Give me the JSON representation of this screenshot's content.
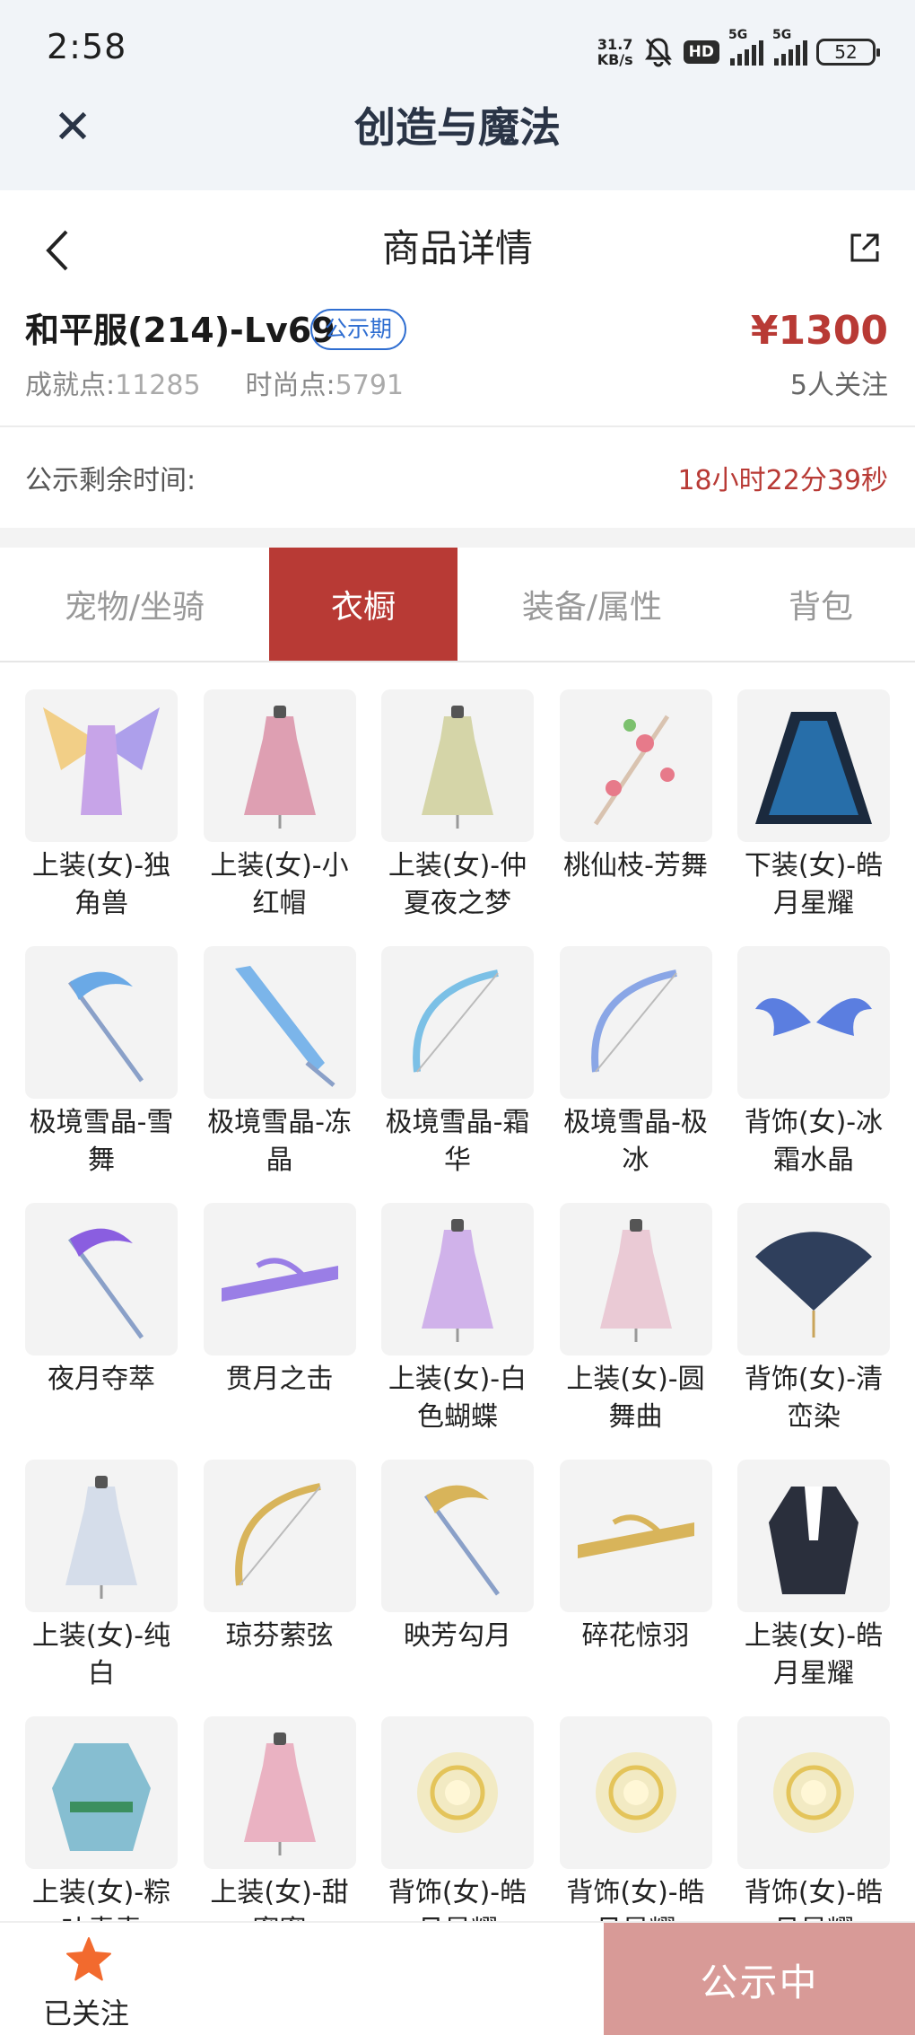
{
  "status": {
    "time": "2:58",
    "net_speed_value": "31.7",
    "net_speed_unit": "KB/s",
    "hd_badge": "HD",
    "signal_1": "5G",
    "signal_2": "5G",
    "battery": "52"
  },
  "app_bar": {
    "title": "创造与魔法",
    "close_icon": "close-icon"
  },
  "nav": {
    "title": "商品详情",
    "back_icon": "chevron-left-icon",
    "share_icon": "share-icon"
  },
  "product": {
    "name": "和平服(214)-Lv69",
    "badge": "公示期",
    "price": "¥1300",
    "follows": "5人关注",
    "achievement_label": "成就点:",
    "achievement_value": "11285",
    "fashion_label": "时尚点:",
    "fashion_value": "5791"
  },
  "remaining": {
    "label": "公示剩余时间:",
    "value": "18小时22分39秒"
  },
  "tabs": [
    {
      "label": "宠物/坐骑",
      "active": false
    },
    {
      "label": "衣橱",
      "active": true
    },
    {
      "label": "装备/属性",
      "active": false
    },
    {
      "label": "背包",
      "active": false
    }
  ],
  "items": [
    {
      "name": "上装(女)-独角兽",
      "icon": "winged-outfit-icon",
      "color": "#c7a4e8"
    },
    {
      "name": "上装(女)-小红帽",
      "icon": "dress-icon",
      "color": "#d98fa6"
    },
    {
      "name": "上装(女)-仲夏夜之梦",
      "icon": "dress-icon",
      "color": "#cfcf9a"
    },
    {
      "name": "桃仙枝-芳舞",
      "icon": "branch-icon",
      "color": "#e77a8a"
    },
    {
      "name": "下装(女)-皓月星耀",
      "icon": "skirt-icon",
      "color": "#2a7fc4"
    },
    {
      "name": "极境雪晶-雪舞",
      "icon": "scythe-icon",
      "color": "#6aa9e6"
    },
    {
      "name": "极境雪晶-冻晶",
      "icon": "sword-icon",
      "color": "#7bb5ea"
    },
    {
      "name": "极境雪晶-霜华",
      "icon": "bow-icon",
      "color": "#7bc0e6"
    },
    {
      "name": "极境雪晶-极冰",
      "icon": "bow-icon",
      "color": "#8aa6e6"
    },
    {
      "name": "背饰(女)-冰霜水晶",
      "icon": "wings-icon",
      "color": "#5b7ee0"
    },
    {
      "name": "夜月夺萃",
      "icon": "scythe-icon",
      "color": "#8a5ee0"
    },
    {
      "name": "贯月之击",
      "icon": "crossbow-icon",
      "color": "#9a7ee6"
    },
    {
      "name": "上装(女)-白色蝴蝶",
      "icon": "dress-icon",
      "color": "#c9a6e8"
    },
    {
      "name": "上装(女)-圆舞曲",
      "icon": "dress-icon",
      "color": "#e8c2cf"
    },
    {
      "name": "背饰(女)-清峦染",
      "icon": "fan-icon",
      "color": "#2f3f5c"
    },
    {
      "name": "上装(女)-纯白",
      "icon": "dress-icon",
      "color": "#cfd8e8"
    },
    {
      "name": "琼芬萦弦",
      "icon": "bow-icon",
      "color": "#d8b45a"
    },
    {
      "name": "映芳勾月",
      "icon": "scythe-icon",
      "color": "#d8b45a"
    },
    {
      "name": "碎花惊羽",
      "icon": "crossbow-icon",
      "color": "#d8b45a"
    },
    {
      "name": "上装(女)-皓月星耀",
      "icon": "jacket-icon",
      "color": "#2a2f3c"
    },
    {
      "name": "上装(女)-粽叶青青",
      "icon": "armor-icon",
      "color": "#6ab0c8"
    },
    {
      "name": "上装(女)-甜蜜蜜",
      "icon": "dress-icon",
      "color": "#e8a6b8"
    },
    {
      "name": "背饰(女)-皓月星耀",
      "icon": "halo-icon",
      "color": "#f2df8a"
    },
    {
      "name": "背饰(女)-皓月星耀",
      "icon": "halo-icon",
      "color": "#f2df8a"
    },
    {
      "name": "背饰(女)-皓月星耀",
      "icon": "halo-icon",
      "color": "#f2df8a"
    }
  ],
  "bottom": {
    "follow_label": "已关注",
    "cta_label": "公示中"
  },
  "colors": {
    "accent": "#b83a35",
    "badge_blue": "#2f6ed1",
    "star": "#f26a2e",
    "cta_bg": "#d89a97"
  }
}
